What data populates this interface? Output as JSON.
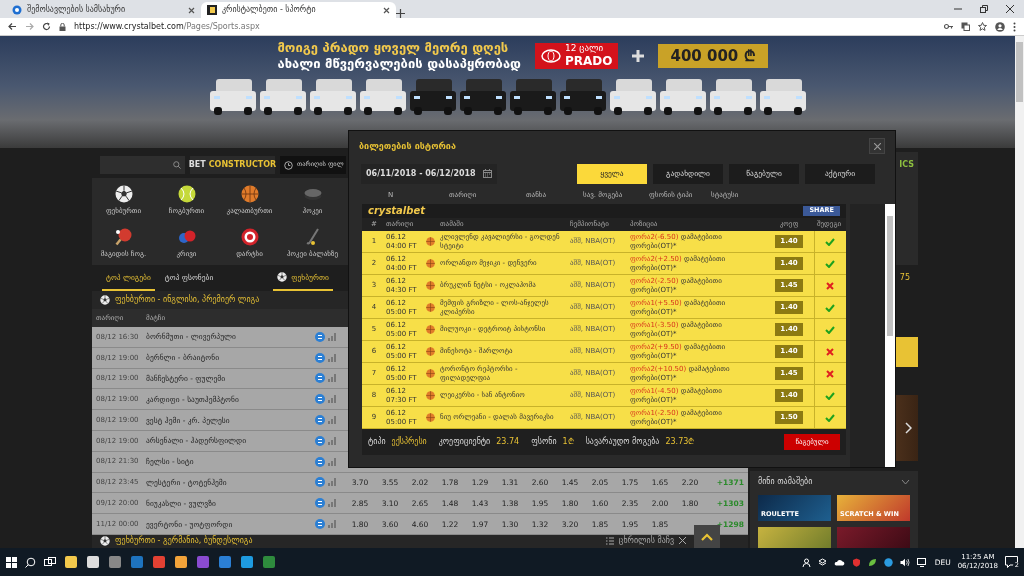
{
  "browser": {
    "tabs": [
      {
        "title": "შემოსავლების სამსახური",
        "selected": false
      },
      {
        "title": "კრისტალბეთი - სპორტი",
        "selected": true
      }
    ],
    "url_host": "https://www.crystalbet.com",
    "url_path": "/Pages/Sports.aspx"
  },
  "banner": {
    "headline": "მოიგე პრადო ყოველ მეორე დღეს",
    "subline": "ახალი მწვერვალების დასაპყრობად",
    "badge_count": "12 ცალი",
    "badge_model": "PRADO",
    "prize": "400 000 ₾"
  },
  "toolbar": {
    "brand_left": "BET",
    "brand_right": "CONSTRUCTOR",
    "date_filter": "თარიღის ფილ"
  },
  "sports": [
    {
      "label": "ფეხბურთი",
      "kind": "soccer"
    },
    {
      "label": "ჩოგბურთი",
      "kind": "tennis"
    },
    {
      "label": "კალათბურთი",
      "kind": "basketball"
    },
    {
      "label": "ჰოკეი",
      "kind": "hockey"
    },
    {
      "label": "მაგიდის ჩოგ.",
      "kind": "tabletennis"
    },
    {
      "label": "კრივი",
      "kind": "boxing"
    },
    {
      "label": "დარტსი",
      "kind": "darts"
    },
    {
      "label": "ჰოკეი ბალახზე",
      "kind": "fieldhockey"
    }
  ],
  "tabs": [
    {
      "label": "ტოპ ლიგები",
      "selected": true
    },
    {
      "label": "ტოპ ფსონები",
      "selected": false
    }
  ],
  "sport_tab": {
    "label": "ფეხბურთი",
    "selected": true
  },
  "count": "75",
  "league": "ფეხბურთი - ინგლისი, პრემიერ ლიგა",
  "columns": [
    "თარიღი",
    "მატჩი"
  ],
  "matches": [
    {
      "date": "08/12 16:30",
      "teams": "ბორნმუთი - ლივერპული"
    },
    {
      "date": "08/12 19:00",
      "teams": "ბერნლი - ბრაიტონი"
    },
    {
      "date": "08/12 19:00",
      "teams": "მანჩესტერი - ფულემი"
    },
    {
      "date": "08/12 19:00",
      "teams": "კარდიფი - საუთჰემპტონი"
    },
    {
      "date": "08/12 19:00",
      "teams": "ვესტ ჰემი - კრ. პელესი"
    },
    {
      "date": "08/12 19:00",
      "teams": "არსენალი - ჰადერსფილდი"
    },
    {
      "date": "08/12 21:30",
      "teams": "ჩელსი - სიტი"
    },
    {
      "date": "08/12 23:45",
      "teams": "ლესტერი - ტოტენჰემი",
      "odds": [
        "3.70",
        "3.55",
        "2.02",
        "1.78",
        "1.29",
        "1.31",
        "2.60",
        "1.45",
        "2.05",
        "1.75",
        "1.65",
        "2.20"
      ],
      "total": "+1371"
    },
    {
      "date": "09/12 20:00",
      "teams": "ნიუკასლი - ვულვზი",
      "odds": [
        "2.85",
        "3.10",
        "2.65",
        "1.48",
        "1.43",
        "1.38",
        "1.95",
        "1.80",
        "1.60",
        "2.35",
        "2.00",
        "1.80"
      ],
      "total": "+1303"
    },
    {
      "date": "11/12 00:00",
      "teams": "ევერტონი - უოტფორდი",
      "odds": [
        "1.80",
        "3.60",
        "4.60",
        "1.22",
        "1.97",
        "1.30",
        "1.32",
        "3.20",
        "1.85",
        "1.95",
        "1.85"
      ],
      "total": "+1298"
    }
  ],
  "next_league": "ფეხბურთი - გერმანია, ბუნდესლიგა",
  "table_settings": "ცხრილის მაჩვ",
  "right": {
    "header_fragment": "ICS",
    "mini_games_title": "მინი თამაშები",
    "games": [
      "ROULETTE",
      "SCRATCH & WIN"
    ]
  },
  "modal": {
    "title": "ბილეთების ისტორია",
    "date_range": "06/11/2018 - 06/12/2018",
    "filters": [
      {
        "label": "ყველა",
        "selected": true
      },
      {
        "label": "გადახდილი",
        "selected": false
      },
      {
        "label": "წაგებული",
        "selected": false
      },
      {
        "label": "აქტიური",
        "selected": false
      }
    ],
    "columns": [
      "N",
      "თარიღი",
      "თანხა",
      "სავ. მოგება",
      "ფსონის ტიპი",
      "სტატუსი"
    ],
    "ticket": {
      "logo": "crystalbet",
      "share": "SHARE",
      "columns": [
        "#",
        "თარიღი",
        "თამაში",
        "ჩემპიონატი",
        "პოზიცია",
        "კოეფ",
        "შედეგი"
      ],
      "rows": [
        {
          "n": "1",
          "date": "06.12",
          "time": "04:00 FT",
          "match": "კლივლენდ კავალიერსი - გოლდენ სტეიტი",
          "league": "აშშ, NBA(OT)",
          "handicap": "ფორა2(-6.50)",
          "position": "დამატებითი ფორები(OT)*",
          "odds": "1.40",
          "won": true
        },
        {
          "n": "2",
          "date": "06.12",
          "time": "04:00 FT",
          "match": "ორლანდო მეჯიკი - დენვერი",
          "league": "აშშ, NBA(OT)",
          "handicap": "ფორა2(+2.50)",
          "position": "დამატებითი ფორები(OT)*",
          "odds": "1.40",
          "won": true
        },
        {
          "n": "3",
          "date": "06.12",
          "time": "04:30 FT",
          "match": "ბრუკლინ ნეტსი - ოკლაჰომა",
          "league": "აშშ, NBA(OT)",
          "handicap": "ფორა2(-2.50)",
          "position": "დამატებითი ფორები(OT)*",
          "odds": "1.45",
          "won": false
        },
        {
          "n": "4",
          "date": "06.12",
          "time": "05:00 FT",
          "match": "მემფის გრიზლი - ლოს-ანჯელეს კლიპერსი",
          "league": "აშშ, NBA(OT)",
          "handicap": "ფორა1(+5.50)",
          "position": "დამატებითი ფორები(OT)*",
          "odds": "1.40",
          "won": true
        },
        {
          "n": "5",
          "date": "06.12",
          "time": "05:00 FT",
          "match": "მილუოკი - დეტროიტ პისტონსი",
          "league": "აშშ, NBA(OT)",
          "handicap": "ფორა1(-3.50)",
          "position": "დამატებითი ფორები(OT)*",
          "odds": "1.40",
          "won": true
        },
        {
          "n": "6",
          "date": "06.12",
          "time": "05:00 FT",
          "match": "მინესოტა - შარლოტა",
          "league": "აშშ, NBA(OT)",
          "handicap": "ფორა2(+9.50)",
          "position": "დამატებითი ფორები(OT)*",
          "odds": "1.40",
          "won": false
        },
        {
          "n": "7",
          "date": "06.12",
          "time": "05:00 FT",
          "match": "ტორონტო რეპტორსი - ფილადელფია",
          "league": "აშშ, NBA(OT)",
          "handicap": "ფორა2(+10.50)",
          "position": "დამატებითი ფორები(OT)*",
          "odds": "1.45",
          "won": false
        },
        {
          "n": "8",
          "date": "06.12",
          "time": "07:30 FT",
          "match": "ლეიკერსი - სან ანტონიო",
          "league": "აშშ, NBA(OT)",
          "handicap": "ფორა1(-4.50)",
          "position": "დამატებითი ფორები(OT)*",
          "odds": "1.40",
          "won": true
        },
        {
          "n": "9",
          "date": "06.12",
          "time": "05:00 FT",
          "match": "ნიუ ორლეანი - დალას მავერიკსი",
          "league": "აშშ, NBA(OT)",
          "handicap": "ფორა1(-2.50)",
          "position": "დამატებითი ფორები(OT)*",
          "odds": "1.50",
          "won": true
        }
      ],
      "summary": [
        {
          "label": "ტიპი",
          "value": "ექსპრესი"
        },
        {
          "label": "კოეფიციენტი",
          "value": "23.74"
        },
        {
          "label": "ფსონი",
          "value": "1₾"
        },
        {
          "label": "სავარაუდო მოგება",
          "value": "23.73₾"
        }
      ],
      "status": "წაგებული"
    }
  },
  "taskbar": {
    "language": "DEU",
    "time": "11:25 AM",
    "date": "06/12/2018",
    "notifications": "2"
  }
}
